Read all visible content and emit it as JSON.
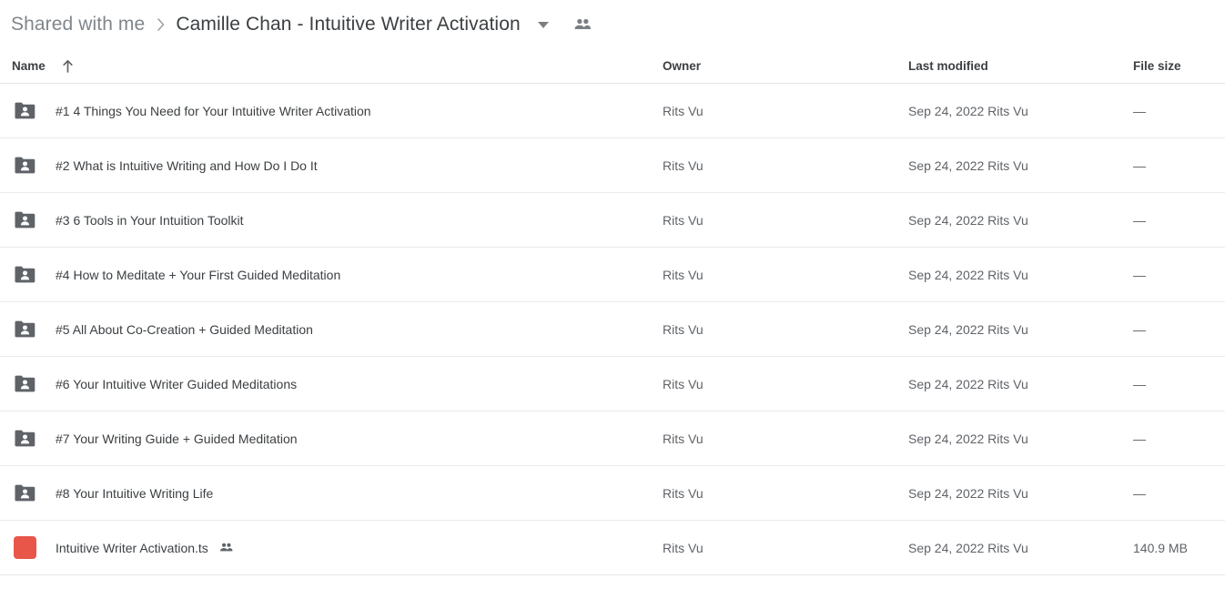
{
  "breadcrumb": {
    "parent": "Shared with me",
    "separator": "›",
    "current": "Camille Chan - Intuitive Writer Activation",
    "caret_icon": "chevron-down-icon",
    "people_icon": "people-shared-icon"
  },
  "columns": {
    "name": "Name",
    "owner": "Owner",
    "modified": "Last modified",
    "size": "File size",
    "sort_icon": "arrow-up-icon",
    "sort_direction": "ascending"
  },
  "colors": {
    "text_primary": "#3c4043",
    "text_secondary": "#5f6368",
    "breadcrumb_parent": "#80868b",
    "folder_icon": "#5f6368",
    "file_badge": "#e8564a",
    "row_divider": "#e8eaed"
  },
  "rows": [
    {
      "icon": "shared-folder-icon",
      "type": "folder",
      "name": "#1 4 Things You Need for Your Intuitive Writer Activation",
      "owner": "Rits Vu",
      "modified": "Sep 24, 2022 Rits Vu",
      "size": "—",
      "shared": false
    },
    {
      "icon": "shared-folder-icon",
      "type": "folder",
      "name": "#2 What is Intuitive Writing and How Do I Do It",
      "owner": "Rits Vu",
      "modified": "Sep 24, 2022 Rits Vu",
      "size": "—",
      "shared": false
    },
    {
      "icon": "shared-folder-icon",
      "type": "folder",
      "name": "#3 6 Tools in Your Intuition Toolkit",
      "owner": "Rits Vu",
      "modified": "Sep 24, 2022 Rits Vu",
      "size": "—",
      "shared": false
    },
    {
      "icon": "shared-folder-icon",
      "type": "folder",
      "name": "#4 How to Meditate + Your First Guided Meditation",
      "owner": "Rits Vu",
      "modified": "Sep 24, 2022 Rits Vu",
      "size": "—",
      "shared": false
    },
    {
      "icon": "shared-folder-icon",
      "type": "folder",
      "name": "#5 All About Co-Creation + Guided Meditation",
      "owner": "Rits Vu",
      "modified": "Sep 24, 2022 Rits Vu",
      "size": "—",
      "shared": false
    },
    {
      "icon": "shared-folder-icon",
      "type": "folder",
      "name": "#6 Your Intuitive Writer Guided Meditations",
      "owner": "Rits Vu",
      "modified": "Sep 24, 2022 Rits Vu",
      "size": "—",
      "shared": false
    },
    {
      "icon": "shared-folder-icon",
      "type": "folder",
      "name": "#7 Your Writing Guide + Guided Meditation",
      "owner": "Rits Vu",
      "modified": "Sep 24, 2022 Rits Vu",
      "size": "—",
      "shared": false
    },
    {
      "icon": "shared-folder-icon",
      "type": "folder",
      "name": "#8 Your Intuitive Writing Life",
      "owner": "Rits Vu",
      "modified": "Sep 24, 2022 Rits Vu",
      "size": "—",
      "shared": false
    },
    {
      "icon": "code-file-icon",
      "type": "file",
      "badge_text": "</>",
      "name": "Intuitive Writer Activation.ts",
      "owner": "Rits Vu",
      "modified": "Sep 24, 2022 Rits Vu",
      "size": "140.9 MB",
      "shared": true
    }
  ]
}
